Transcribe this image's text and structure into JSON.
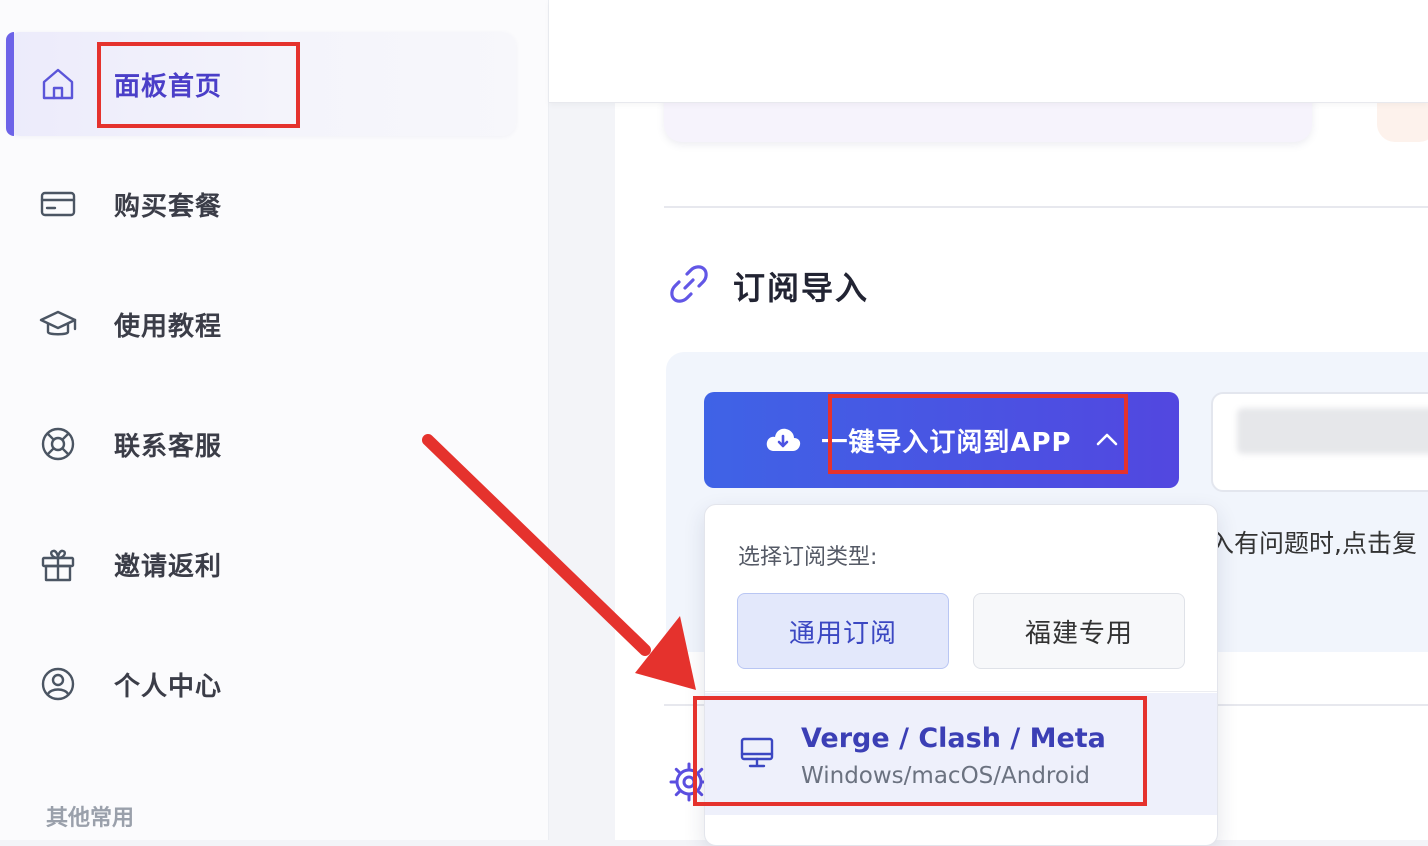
{
  "sidebar": {
    "items": [
      {
        "label": "面板首页",
        "icon": "home-icon",
        "active": true
      },
      {
        "label": "购买套餐",
        "icon": "credit-card-icon",
        "active": false
      },
      {
        "label": "使用教程",
        "icon": "graduation-cap-icon",
        "active": false
      },
      {
        "label": "联系客服",
        "icon": "lifebuoy-icon",
        "active": false
      },
      {
        "label": "邀请返利",
        "icon": "gift-icon",
        "active": false
      },
      {
        "label": "个人中心",
        "icon": "user-circle-icon",
        "active": false
      }
    ],
    "section_title": "其他常用"
  },
  "main": {
    "section_title": "订阅导入",
    "import_button_label": "一键导入订阅到APP",
    "hint_text": "入有问题时,点击复"
  },
  "dropdown": {
    "title": "选择订阅类型:",
    "types": [
      {
        "label": "通用订阅",
        "selected": true
      },
      {
        "label": "福建专用",
        "selected": false
      }
    ],
    "app_option": {
      "name": "Verge / Clash / Meta",
      "platforms": "Windows/macOS/Android"
    }
  },
  "colors": {
    "accent": "#5247e0",
    "annotation": "#e5322d"
  }
}
